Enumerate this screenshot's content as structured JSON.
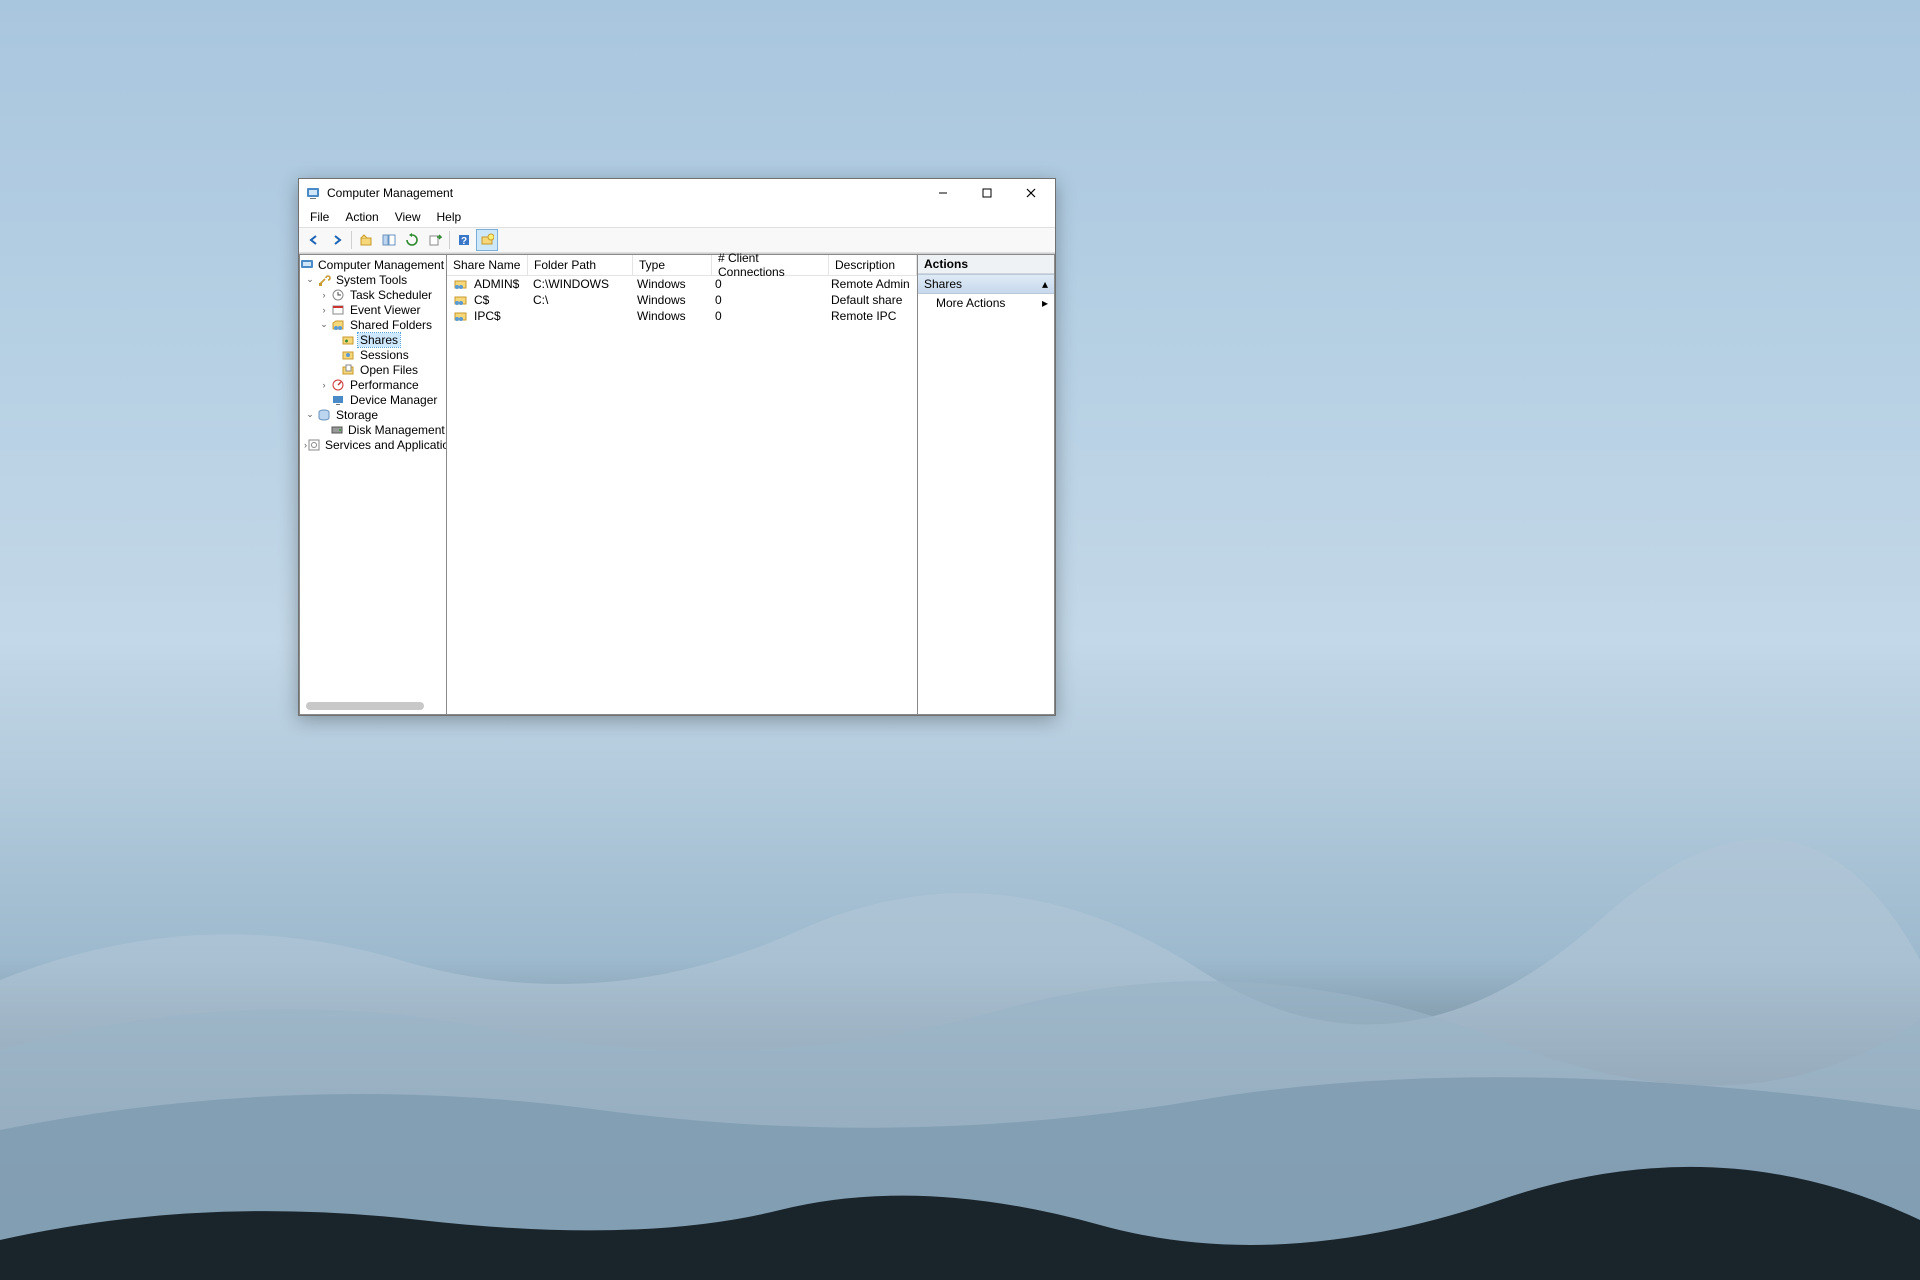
{
  "title": "Computer Management",
  "menu": {
    "file": "File",
    "action": "Action",
    "view": "View",
    "help": "Help"
  },
  "tree": {
    "root": "Computer Management (Local",
    "system_tools": "System Tools",
    "task_scheduler": "Task Scheduler",
    "event_viewer": "Event Viewer",
    "shared_folders": "Shared Folders",
    "shares": "Shares",
    "sessions": "Sessions",
    "open_files": "Open Files",
    "performance": "Performance",
    "device_manager": "Device Manager",
    "storage": "Storage",
    "disk_management": "Disk Management",
    "services_apps": "Services and Applications"
  },
  "columns": {
    "c0": "Share Name",
    "c1": "Folder Path",
    "c2": "Type",
    "c3": "# Client Connections",
    "c4": "Description"
  },
  "rows": [
    {
      "name": "ADMIN$",
      "path": "C:\\WINDOWS",
      "type": "Windows",
      "conn": "0",
      "desc": "Remote Admin"
    },
    {
      "name": "C$",
      "path": "C:\\",
      "type": "Windows",
      "conn": "0",
      "desc": "Default share"
    },
    {
      "name": "IPC$",
      "path": "",
      "type": "Windows",
      "conn": "0",
      "desc": "Remote IPC"
    }
  ],
  "actions": {
    "header": "Actions",
    "section": "Shares",
    "more": "More Actions"
  }
}
